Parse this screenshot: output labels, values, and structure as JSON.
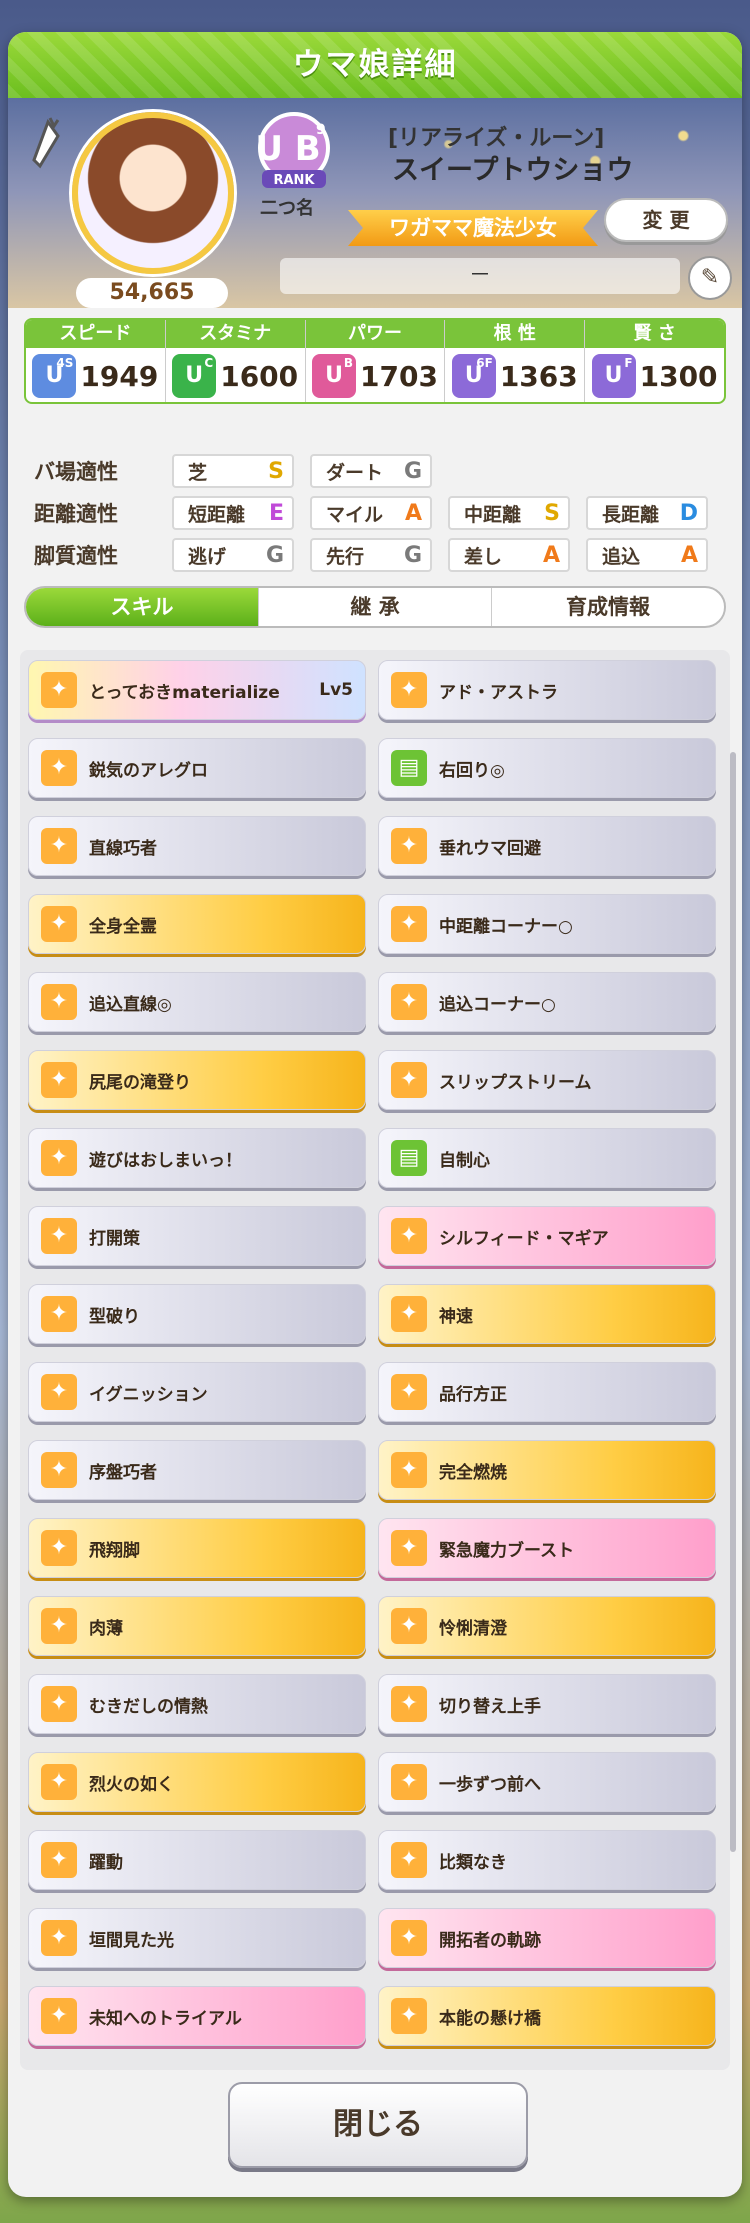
{
  "window": {
    "title": "ウマ娘詳細"
  },
  "profile": {
    "epithet": "[リアライズ・ルーン]",
    "name": "スイープトウショウ",
    "nickname": "二つ名",
    "rank": "U B",
    "rank_sub": "9",
    "rank_label": "RANK",
    "fans": "54,665",
    "title_ribbon": "ワガママ魔法少女",
    "change_label": "変 更",
    "memo": "－"
  },
  "stats": [
    {
      "label": "スピード",
      "grade": "U",
      "grade_sub": "4S",
      "value": "1949",
      "color": "#5e8ce0"
    },
    {
      "label": "スタミナ",
      "grade": "U",
      "grade_sub": "C",
      "value": "1600",
      "color": "#3ab34a"
    },
    {
      "label": "パワー",
      "grade": "U",
      "grade_sub": "B",
      "value": "1703",
      "color": "#e05a9a"
    },
    {
      "label": "根 性",
      "grade": "U",
      "grade_sub": "6F",
      "value": "1363",
      "color": "#8c6ad8"
    },
    {
      "label": "賢 さ",
      "grade": "U",
      "grade_sub": "F",
      "value": "1300",
      "color": "#8c6ad8"
    }
  ],
  "aptitude": {
    "track": {
      "label": "バ場適性",
      "items": [
        {
          "name": "芝",
          "grade": "S"
        },
        {
          "name": "ダート",
          "grade": "G"
        }
      ]
    },
    "distance": {
      "label": "距離適性",
      "items": [
        {
          "name": "短距離",
          "grade": "E"
        },
        {
          "name": "マイル",
          "grade": "A"
        },
        {
          "name": "中距離",
          "grade": "S"
        },
        {
          "name": "長距離",
          "grade": "D"
        }
      ]
    },
    "style": {
      "label": "脚質適性",
      "items": [
        {
          "name": "逃げ",
          "grade": "G"
        },
        {
          "name": "先行",
          "grade": "G"
        },
        {
          "name": "差し",
          "grade": "A"
        },
        {
          "name": "追込",
          "grade": "A"
        }
      ]
    },
    "grade_colors": {
      "S": "#e0a800",
      "A": "#f07a1a",
      "D": "#2a8ce0",
      "E": "#c04ad8",
      "G": "#7a7a7a"
    }
  },
  "tabs": [
    {
      "label": "スキル"
    },
    {
      "label": "継 承"
    },
    {
      "label": "育成情報"
    }
  ],
  "skills": [
    {
      "name": "とっておきmaterialize",
      "level": "Lv5",
      "style": "rainbow"
    },
    {
      "name": "アド・アストラ",
      "style": "white"
    },
    {
      "name": "鋭気のアレグロ",
      "style": "white"
    },
    {
      "name": "右回り◎",
      "style": "white",
      "icon": "green"
    },
    {
      "name": "直線巧者",
      "style": "white"
    },
    {
      "name": "垂れウマ回避",
      "style": "white"
    },
    {
      "name": "全身全霊",
      "style": "gold"
    },
    {
      "name": "中距離コーナー○",
      "style": "white"
    },
    {
      "name": "追込直線◎",
      "style": "white"
    },
    {
      "name": "追込コーナー○",
      "style": "white"
    },
    {
      "name": "尻尾の滝登り",
      "style": "gold"
    },
    {
      "name": "スリップストリーム",
      "style": "white"
    },
    {
      "name": "遊びはおしまいっ！",
      "style": "white"
    },
    {
      "name": "自制心",
      "style": "white",
      "icon": "green"
    },
    {
      "name": "打開策",
      "style": "white"
    },
    {
      "name": "シルフィード・マギア",
      "style": "pink"
    },
    {
      "name": "型破り",
      "style": "white"
    },
    {
      "name": "神速",
      "style": "gold"
    },
    {
      "name": "イグニッション",
      "style": "white"
    },
    {
      "name": "品行方正",
      "style": "white"
    },
    {
      "name": "序盤巧者",
      "style": "white"
    },
    {
      "name": "完全燃焼",
      "style": "gold"
    },
    {
      "name": "飛翔脚",
      "style": "gold"
    },
    {
      "name": "緊急魔力ブースト",
      "style": "pink"
    },
    {
      "name": "肉薄",
      "style": "gold"
    },
    {
      "name": "怜悧清澄",
      "style": "gold"
    },
    {
      "name": "むきだしの情熱",
      "style": "white"
    },
    {
      "name": "切り替え上手",
      "style": "white"
    },
    {
      "name": "烈火の如く",
      "style": "gold"
    },
    {
      "name": "一歩ずつ前へ",
      "style": "white"
    },
    {
      "name": "躍動",
      "style": "white"
    },
    {
      "name": "比類なき",
      "style": "white"
    },
    {
      "name": "垣間見た光",
      "style": "white"
    },
    {
      "name": "開拓者の軌跡",
      "style": "pink"
    },
    {
      "name": "未知へのトライアル",
      "style": "pink"
    },
    {
      "name": "本能の懸け橋",
      "style": "gold"
    }
  ],
  "footer": {
    "close_label": "閉じる"
  }
}
